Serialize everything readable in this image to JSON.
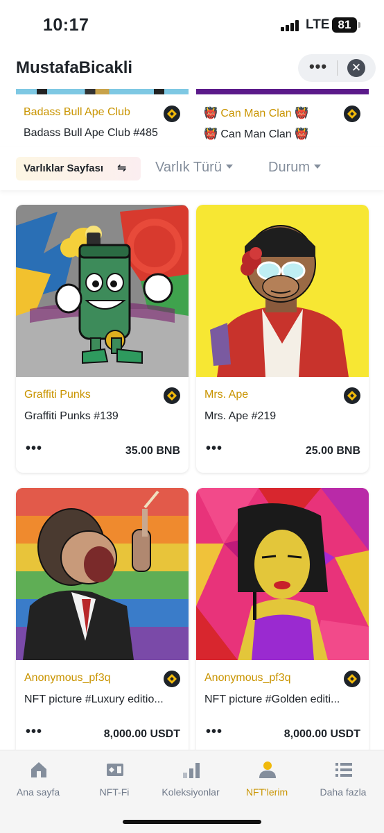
{
  "status_bar": {
    "time": "10:17",
    "network": "LTE",
    "battery": "81"
  },
  "header": {
    "title": "MustafaBicakli",
    "more_label": "•••",
    "close_label": "✕"
  },
  "top_cards": [
    {
      "collection": "Badass Bull Ape Club",
      "item": "Badass Bull Ape Club #485"
    },
    {
      "collection": "👹 Can Man Clan 👹",
      "item": "👹 Can Man Clan 👹"
    }
  ],
  "filters": {
    "page_chip": "Varlıklar Sayfası",
    "asset_type": "Varlık Türü",
    "status": "Durum"
  },
  "cards": [
    {
      "collection": "Graffiti Punks",
      "item": "Graffiti Punks #139",
      "more": "•••",
      "price": "35.00 BNB"
    },
    {
      "collection": "Mrs. Ape",
      "item": "Mrs. Ape #219",
      "more": "•••",
      "price": "25.00 BNB"
    },
    {
      "collection": "Anonymous_pf3q",
      "item": "NFT picture #Luxury editio...",
      "more": "•••",
      "price": "8,000.00 USDT"
    },
    {
      "collection": "Anonymous_pf3q",
      "item": "NFT picture #Golden editi...",
      "more": "•••",
      "price": "8,000.00 USDT"
    }
  ],
  "bottom_nav": [
    {
      "label": "Ana sayfa",
      "icon": "home-icon"
    },
    {
      "label": "NFT-Fi",
      "icon": "nft-fi-icon"
    },
    {
      "label": "Koleksiyonlar",
      "icon": "collections-icon"
    },
    {
      "label": "NFT'lerim",
      "icon": "profile-icon",
      "active": true
    },
    {
      "label": "Daha fazla",
      "icon": "list-icon"
    }
  ],
  "colors": {
    "accent": "#c99400",
    "bnb_yellow": "#f0b90b",
    "text": "#1e2329",
    "muted": "#848e9c"
  }
}
